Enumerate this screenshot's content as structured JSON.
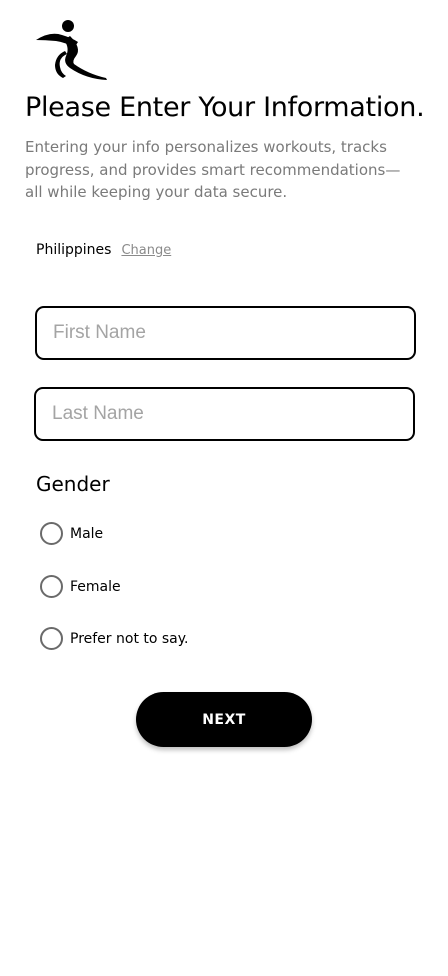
{
  "header": {
    "logo_icon": "running-figure-icon",
    "title": "Please Enter Your Information.",
    "subtitle": "Entering your info personalizes workouts, tracks progress, and provides smart recommendations—all while keeping your data secure."
  },
  "country": {
    "name": "Philippines",
    "change_label": "Change"
  },
  "form": {
    "first_name": {
      "value": "",
      "placeholder": "First Name"
    },
    "last_name": {
      "value": "",
      "placeholder": "Last Name"
    }
  },
  "gender": {
    "label": "Gender",
    "selected": null,
    "options": [
      {
        "label": "Male"
      },
      {
        "label": "Female"
      },
      {
        "label": "Prefer not to say."
      }
    ]
  },
  "actions": {
    "next_label": "NEXT"
  },
  "colors": {
    "primary": "#000000",
    "placeholder": "#a4a4a4",
    "subtitle": "#7a7a7a",
    "link": "#8a8a8a",
    "background": "#ffffff"
  }
}
